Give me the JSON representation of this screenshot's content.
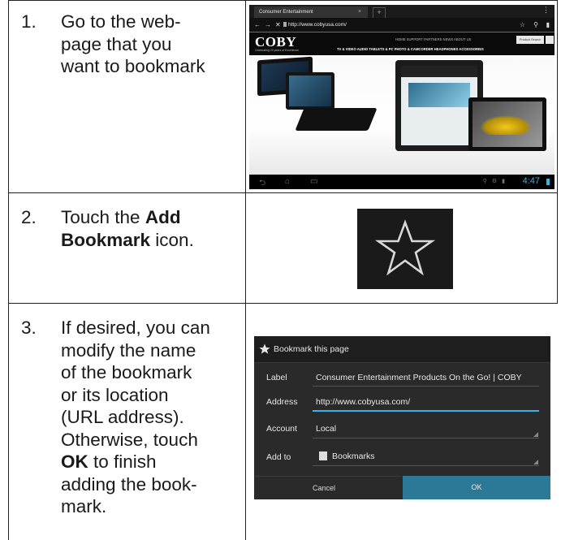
{
  "steps": [
    {
      "number": "1.",
      "lines": [
        "Go to the web-",
        "page that you",
        "want to bookmark"
      ]
    },
    {
      "number": "2.",
      "pre": "Touch the ",
      "bold1": "Add",
      "bold2": "Bookmark",
      "post": " icon."
    },
    {
      "number": "3.",
      "lines": [
        "If desired, you can",
        "modify the name",
        "of the bookmark",
        "or its location",
        "(URL address).",
        "Otherwise, touch"
      ],
      "bold": "OK",
      "after_bold": " to finish",
      "tail": [
        "adding the book-",
        "mark."
      ]
    }
  ],
  "browser": {
    "tab_title": "Consumer Entertainment",
    "tab_close": "×",
    "new_tab": "+",
    "menu": "⋮",
    "back": "←",
    "forward": "→",
    "stop": "✕",
    "url": "http://www.cobyusa.com/",
    "star": "☆",
    "search": "⚲",
    "bookmarks": "▮",
    "logo": "COBY",
    "logo_sub": "Celebrating 20 years of Excellence",
    "top_nav": "HOME    SUPPORT    PARTNERS    NEWS    ABOUT US",
    "product_search": "Product Search",
    "main_nav": "TV & VIDEO    AUDIO    TABLETS & PC    PHOTO & CAMCORDER    HEADPHONES    ACCESSORIES",
    "clock": "4:47"
  },
  "dialog": {
    "title": "Bookmark this page",
    "fields": [
      {
        "label": "Label",
        "value": "Consumer Entertainment Products On the Go! | COBY"
      },
      {
        "label": "Address",
        "value": "http://www.cobyusa.com/"
      },
      {
        "label": "Account",
        "value": "Local"
      },
      {
        "label": "Add to",
        "value": "Bookmarks"
      }
    ],
    "cancel": "Cancel",
    "ok": "OK"
  },
  "colors": {
    "accent": "#33b5e5",
    "ok_button": "#2b7897",
    "dialog_bg": "#2a2a2a"
  }
}
